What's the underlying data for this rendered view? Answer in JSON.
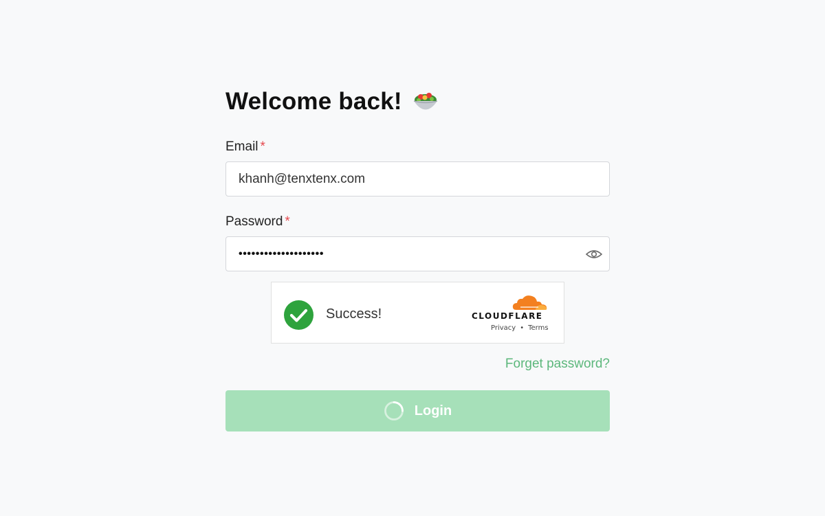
{
  "heading": {
    "title": "Welcome back!",
    "emoji_icon": "salad-bowl-icon"
  },
  "fields": {
    "email": {
      "label": "Email",
      "required_mark": "*",
      "value": "khanh@tenxtenx.com"
    },
    "password": {
      "label": "Password",
      "required_mark": "*",
      "value_masked": "••••••••••••••••••••",
      "toggle_icon": "eye-icon"
    }
  },
  "captcha": {
    "status_icon": "check-circle-icon",
    "status_text": "Success!",
    "provider": "CLOUDFLARE",
    "privacy_link": "Privacy",
    "separator": "•",
    "terms_link": "Terms"
  },
  "links": {
    "forget_password": "Forget password?"
  },
  "login_button": {
    "label": "Login",
    "state": "loading",
    "spinner_icon": "loading-spinner-icon"
  },
  "colors": {
    "page_background": "#f8f9fa",
    "required_asterisk": "#e5484d",
    "link_green": "#5cb77b",
    "button_green_disabled": "#a6e0b9",
    "success_green": "#2ea33d",
    "cloudflare_orange": "#f38020"
  }
}
